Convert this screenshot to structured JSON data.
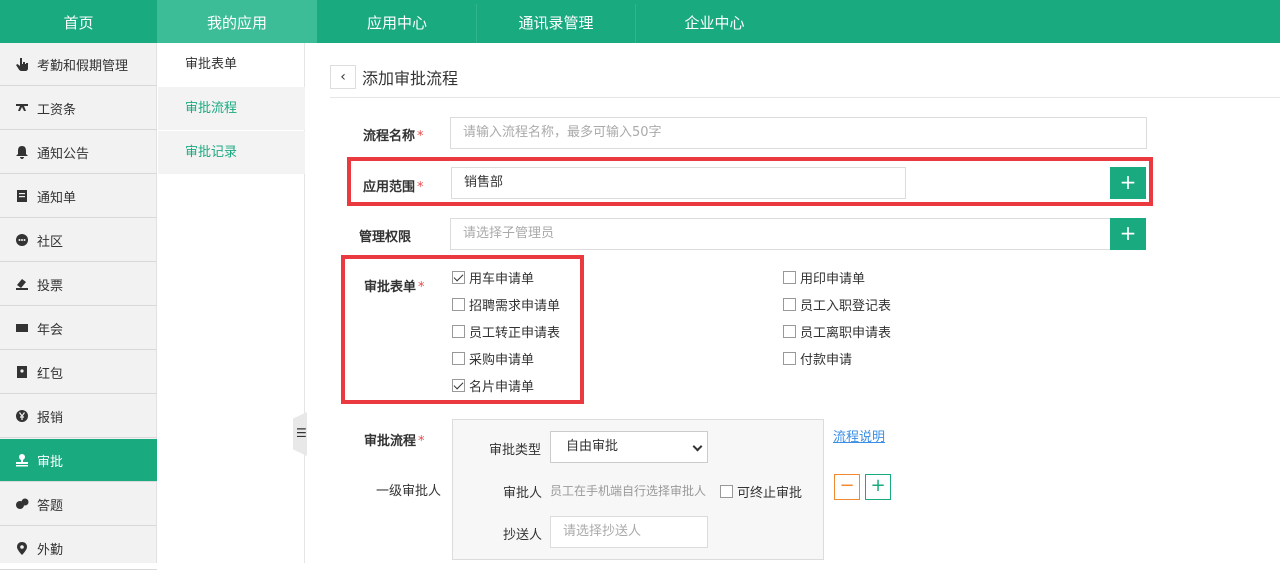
{
  "topnav": {
    "tabs": [
      "首页",
      "我的应用",
      "应用中心",
      "通讯录管理",
      "企业中心"
    ],
    "active_index": 1
  },
  "sidebar": {
    "items": [
      {
        "label": "考勤和假期管理",
        "icon": "hand-pointer-icon"
      },
      {
        "label": "工资条",
        "icon": "money-icon"
      },
      {
        "label": "通知公告",
        "icon": "bell-icon"
      },
      {
        "label": "通知单",
        "icon": "document-icon"
      },
      {
        "label": "社区",
        "icon": "chat-bubble-icon"
      },
      {
        "label": "投票",
        "icon": "vote-icon"
      },
      {
        "label": "年会",
        "icon": "screen-icon"
      },
      {
        "label": "红包",
        "icon": "red-envelope-icon"
      },
      {
        "label": "报销",
        "icon": "yen-icon"
      },
      {
        "label": "审批",
        "icon": "stamp-icon"
      },
      {
        "label": "答题",
        "icon": "quiz-icon"
      },
      {
        "label": "外勤",
        "icon": "location-pin-icon"
      }
    ],
    "active_index": 9
  },
  "subnav": {
    "items": [
      "审批表单",
      "审批流程",
      "审批记录"
    ],
    "selected_index": 1
  },
  "page": {
    "title": "添加审批流程"
  },
  "form": {
    "name_label": "流程名称",
    "name_placeholder": "请输入流程名称，最多可输入50字",
    "scope_label": "应用范围",
    "scope_value": "销售部",
    "admin_label": "管理权限",
    "admin_placeholder": "请选择子管理员",
    "forms_label": "审批表单",
    "required_mark": "*",
    "add_symbol": "+",
    "forms_left": [
      {
        "label": "用车申请单",
        "checked": true
      },
      {
        "label": "招聘需求申请单",
        "checked": false
      },
      {
        "label": "员工转正申请表",
        "checked": false
      },
      {
        "label": "采购申请单",
        "checked": false
      },
      {
        "label": "名片申请单",
        "checked": true
      }
    ],
    "forms_right": [
      {
        "label": "用印申请单",
        "checked": false
      },
      {
        "label": "员工入职登记表",
        "checked": false
      },
      {
        "label": "员工离职申请表",
        "checked": false
      },
      {
        "label": "付款申请",
        "checked": false
      }
    ],
    "flow_label": "审批流程",
    "level_label": "一级审批人",
    "type_label": "审批类型",
    "type_value": "自由审批",
    "approver_label": "审批人",
    "approver_hint": "员工在手机端自行选择审批人",
    "terminate_label": "可终止审批",
    "terminate_checked": false,
    "cc_label": "抄送人",
    "cc_placeholder": "请选择抄送人",
    "flow_help_link": "流程说明",
    "minus_symbol": "−",
    "plus_symbol": "+"
  },
  "colors": {
    "brand_green": "#1aaa80",
    "highlight_red": "#ea3a3f",
    "minus_orange": "#f0892f"
  }
}
